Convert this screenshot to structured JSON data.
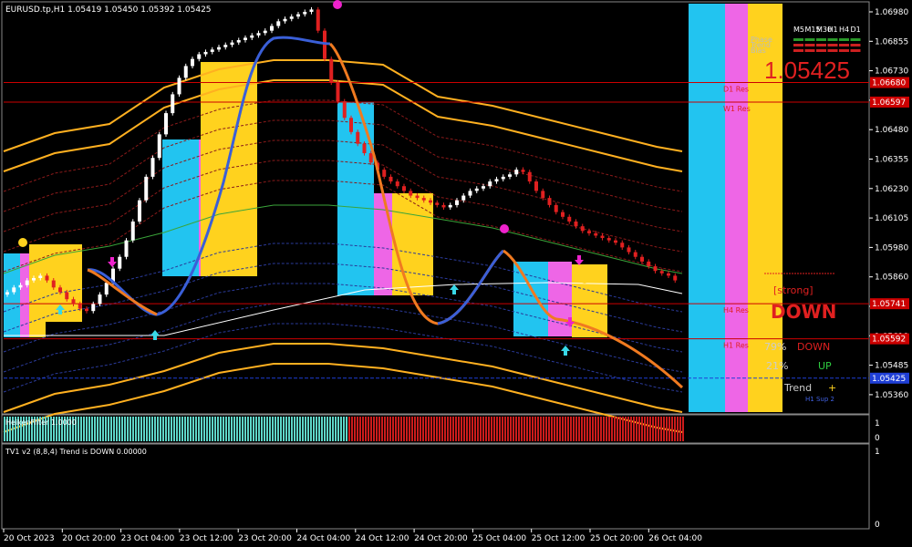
{
  "symbol_line": "EURUSD.tp,H1  1.05419 1.05450 1.05392 1.05425",
  "current_price": "1.05425",
  "price_axis": [
    "1.06980",
    "1.06855",
    "1.06730",
    "1.06605",
    "1.06480",
    "1.06355",
    "1.06230",
    "1.06105",
    "1.05980",
    "1.05860",
    "1.05735",
    "1.05610",
    "1.05485",
    "1.05360"
  ],
  "price_tags": [
    {
      "label": "1.06680",
      "color": "#cc0000"
    },
    {
      "label": "1.06597",
      "color": "#cc0000"
    },
    {
      "label": "1.05741",
      "color": "#cc0000"
    },
    {
      "label": "1.05592",
      "color": "#cc0000"
    },
    {
      "label": "1.05425",
      "color": "#1f3fd6"
    }
  ],
  "levels": [
    {
      "label": "D1 Res",
      "price": 1.0668
    },
    {
      "label": "W1 Res",
      "price": 1.06597
    },
    {
      "label": "H4 Res",
      "price": 1.05741
    },
    {
      "label": "H1 Res",
      "price": 1.05592
    }
  ],
  "timeframe_panel": {
    "labels": [
      "M5",
      "M15",
      "M30",
      "H1",
      "H4",
      "D1"
    ],
    "row_labels": [
      "Phase",
      "Trend",
      "Bias"
    ]
  },
  "signal_panel": {
    "strong_label": "[strong]",
    "direction": "DOWN",
    "down_pct": "79%",
    "down_label": "DOWN",
    "up_pct": "21%",
    "up_label": "UP",
    "trend_label": "Trend",
    "trend_sign": "+",
    "h1_sup": "H1 Sup 2"
  },
  "heiken_label": "HeikenFilter 1.0000",
  "heiken_axis": [
    "1",
    "0"
  ],
  "tv1_label": "TV1 v2 (8,8,4) Trend is DOWN 0.00000",
  "tv1_axis": [
    "1",
    "0"
  ],
  "time_axis": [
    "20 Oct 2023",
    "20 Oct 20:00",
    "23 Oct 04:00",
    "23 Oct 12:00",
    "23 Oct 20:00",
    "24 Oct 04:00",
    "24 Oct 12:00",
    "24 Oct 20:00",
    "25 Oct 04:00",
    "25 Oct 12:00",
    "25 Oct 20:00",
    "26 Oct 04:00"
  ],
  "colors": {
    "cyan": "#22c4f0",
    "magenta": "#ee66e6",
    "yellow": "#ffd21e",
    "red": "#e02020",
    "blue_line": "#3a5fd8",
    "orange_line": "#f07a20",
    "up_hist": "#5ed6c8",
    "down_hist": "#cc1c1c"
  }
}
